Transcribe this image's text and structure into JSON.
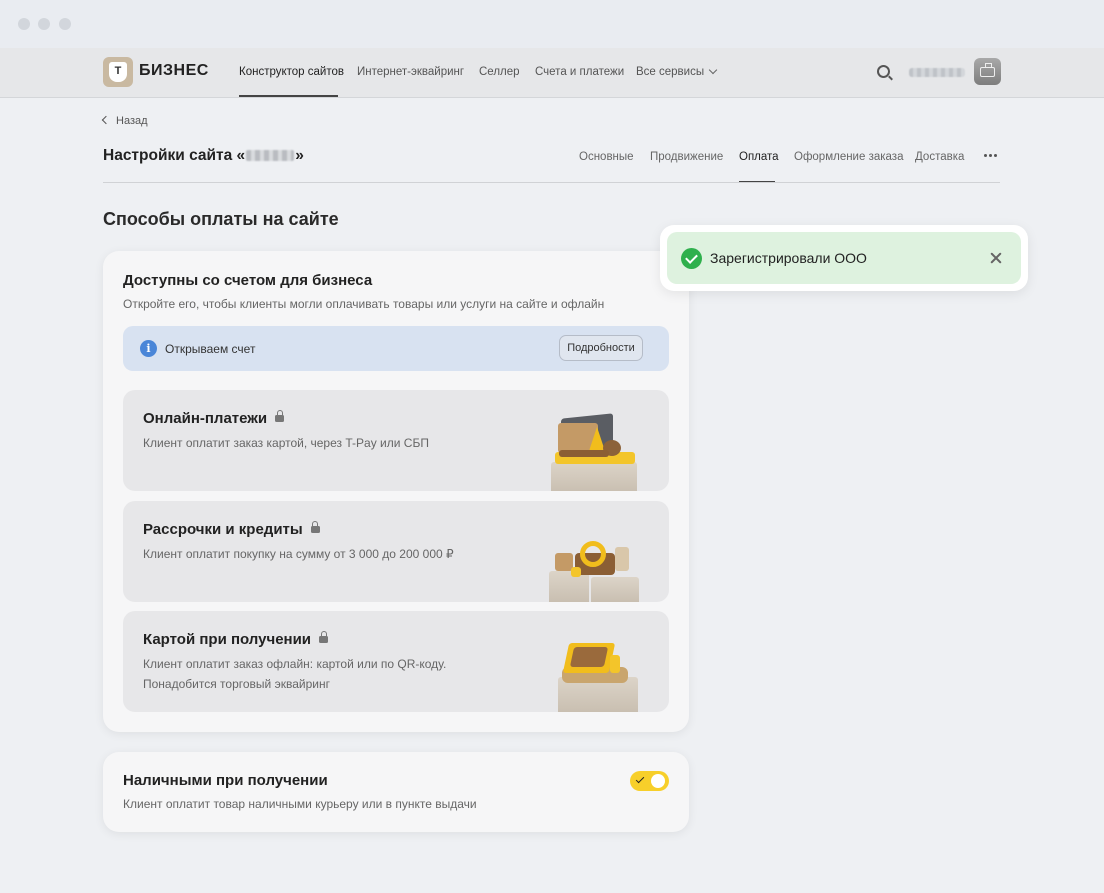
{
  "brand": {
    "name": "БИЗНЕС",
    "logo_letter": "T"
  },
  "nav": {
    "items": [
      "Конструктор сайтов",
      "Интернет-эквайринг",
      "Селлер",
      "Счета и платежи",
      "Все сервисы"
    ],
    "active_index": 0
  },
  "back_label": "Назад",
  "page": {
    "title_prefix": "Настройки сайта «",
    "title_suffix": "»"
  },
  "tabs": {
    "items": [
      "Основные",
      "Продвижение",
      "Оплата",
      "Оформление заказа",
      "Доставка"
    ],
    "active_index": 2
  },
  "section_title": "Способы оплаты на сайте",
  "business_card": {
    "title": "Доступны со счетом для бизнеса",
    "subtitle": "Откройте его, чтобы клиенты могли оплачивать товары или услуги на сайте и офлайн",
    "info_text": "Открываем счет",
    "details_button": "Подробности",
    "info_icon": "i"
  },
  "methods": [
    {
      "title": "Онлайн-платежи",
      "desc": [
        "Клиент оплатит заказ картой, через T-Pay или СБП"
      ]
    },
    {
      "title": "Рассрочки и кредиты",
      "desc": [
        "Клиент оплатит покупку на сумму от 3 000 до 200 000 ₽"
      ]
    },
    {
      "title": "Картой при получении",
      "desc": [
        "Клиент оплатит заказ офлайн: картой или по QR-коду.",
        "Понадобится торговый эквайринг"
      ]
    }
  ],
  "cash_card": {
    "title": "Наличными при получении",
    "subtitle": "Клиент оплатит товар наличными курьеру или в пункте выдачи",
    "enabled": true
  },
  "toast": {
    "text": "Зарегистрировали ООО"
  },
  "colors": {
    "toggle_on": "#f7cf2a",
    "toast_bg": "#def2df",
    "success": "#2fb04d",
    "info_bg": "#d8e2f1",
    "info_icon": "#4a86d8"
  }
}
